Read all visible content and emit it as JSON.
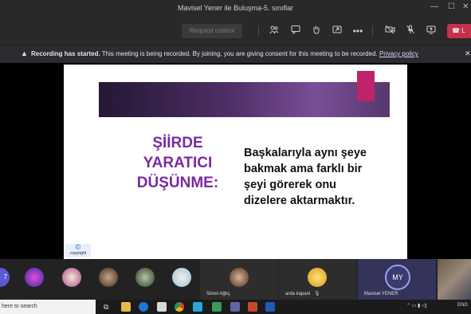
{
  "window": {
    "title": "Mavisel Yener ile Buluşma-5. sınıflar"
  },
  "toolbar": {
    "request_control": "Request control",
    "leave_label": "L"
  },
  "banner": {
    "bold": "Recording has started.",
    "text": "This meeting is being recorded. By joining, you are giving consent for this meeting to be recorded.",
    "link": "Privacy policy"
  },
  "slide": {
    "heading": [
      "ŞİİRDE",
      "YARATICI",
      "DÜŞÜNME:"
    ],
    "body": [
      "Başkalarıyla aynı şeye",
      "bakmak ama farklı bir",
      "şeyi görerek onu",
      "dizelere aktarmaktır."
    ],
    "copyright_label": "copyright"
  },
  "participants": {
    "overflow_count": "7",
    "tiles": [
      {
        "name": "Simel Ağlıç"
      },
      {
        "name": "arda kapani"
      },
      {
        "name": "Mavisel YENER",
        "initials": "MY"
      }
    ]
  },
  "taskbar": {
    "search_text": "here to search",
    "lang": "ENG"
  },
  "colors": {
    "accent_purple": "#7b2aa0",
    "leave_red": "#c4314b",
    "slide_band": "#4e2f66",
    "pink_block": "#c0226b"
  }
}
